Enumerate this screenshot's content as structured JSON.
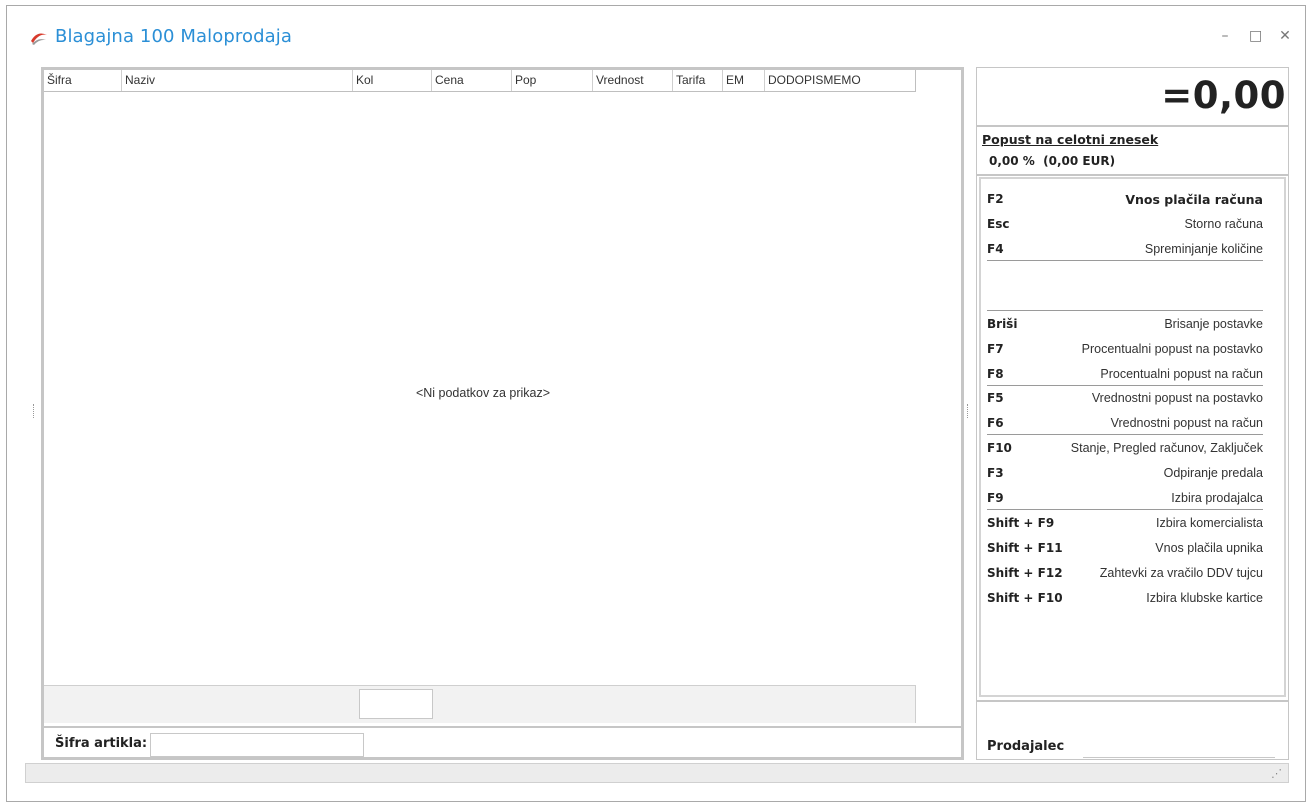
{
  "window": {
    "title": "Blagajna  100 Maloprodaja",
    "minimize": "–",
    "maximize": "□",
    "close": "✕"
  },
  "grid": {
    "columns": [
      "Šifra",
      "Naziv",
      "Kol",
      "Cena",
      "Pop",
      "Vrednost",
      "Tarifa",
      "EM",
      "DODOPISMEMO"
    ],
    "empty_text": "<Ni podatkov za prikaz>"
  },
  "article": {
    "label": "Šifra artikla:",
    "value": ""
  },
  "total": {
    "value": "=0,00"
  },
  "discount": {
    "title": "Popust na celotni znesek",
    "value": "0,00 %  (0,00 EUR)"
  },
  "shortcuts": [
    {
      "key": "F2",
      "desc": "Vnos plačila računa",
      "bold": true
    },
    {
      "key": "Esc",
      "desc": "Storno računa"
    },
    {
      "key": "F4",
      "desc": "Spreminjanje količine"
    },
    {
      "key": "Briši",
      "desc": "Brisanje postavke"
    },
    {
      "key": "F7",
      "desc": "Procentualni popust na postavko"
    },
    {
      "key": "F8",
      "desc": "Procentualni popust na račun"
    },
    {
      "key": "F5",
      "desc": "Vrednostni popust na postavko"
    },
    {
      "key": "F6",
      "desc": "Vrednostni popust na račun"
    },
    {
      "key": "F10",
      "desc": "Stanje, Pregled računov, Zaključek"
    },
    {
      "key": "F3",
      "desc": "Odpiranje predala"
    },
    {
      "key": "F9",
      "desc": "Izbira prodajalca"
    },
    {
      "key": "Shift + F9",
      "desc": "Izbira komercialista"
    },
    {
      "key": "Shift + F11",
      "desc": "Vnos plačila upnika"
    },
    {
      "key": "Shift + F12",
      "desc": "Zahtevki za vračilo DDV tujcu"
    },
    {
      "key": "Shift + F10",
      "desc": "Izbira klubske kartice"
    }
  ],
  "seller": {
    "label": "Prodajalec",
    "value": ""
  },
  "icons": {
    "app": "app-logo-icon",
    "grip": "resize-grip-icon"
  }
}
